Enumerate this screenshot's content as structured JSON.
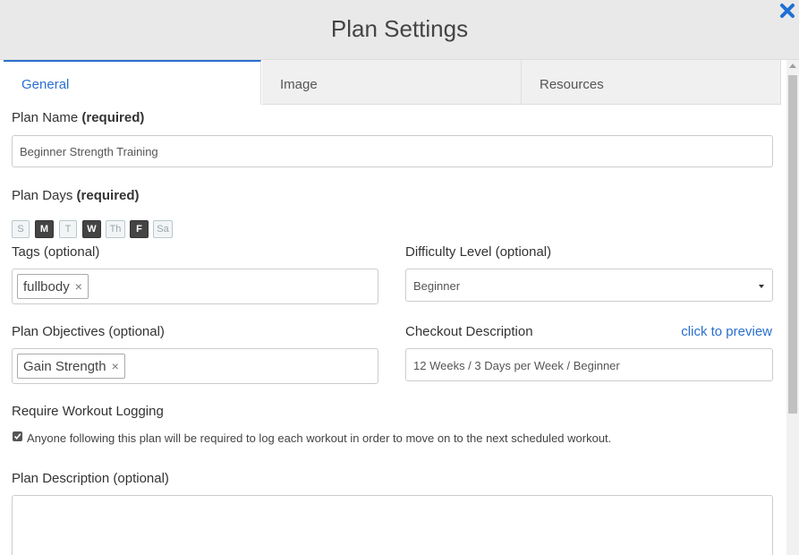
{
  "header": {
    "title": "Plan Settings"
  },
  "tabs": [
    {
      "label": "General",
      "active": true
    },
    {
      "label": "Image",
      "active": false
    },
    {
      "label": "Resources",
      "active": false
    }
  ],
  "plan_name": {
    "label": "Plan Name",
    "required": "(required)",
    "value": "Beginner Strength Training"
  },
  "plan_days": {
    "label": "Plan Days",
    "required": "(required)",
    "days": [
      {
        "label": "S",
        "selected": false
      },
      {
        "label": "M",
        "selected": true
      },
      {
        "label": "T",
        "selected": false
      },
      {
        "label": "W",
        "selected": true
      },
      {
        "label": "Th",
        "selected": false
      },
      {
        "label": "F",
        "selected": true
      },
      {
        "label": "Sa",
        "selected": false
      }
    ]
  },
  "tags": {
    "label": "Tags (optional)",
    "chips": [
      "fullbody"
    ]
  },
  "difficulty": {
    "label": "Difficulty Level (optional)",
    "value": "Beginner"
  },
  "objectives": {
    "label": "Plan Objectives (optional)",
    "chips": [
      "Gain Strength"
    ]
  },
  "checkout": {
    "label": "Checkout Description",
    "preview_link": "click to preview",
    "value": "12 Weeks / 3 Days per Week / Beginner"
  },
  "logging": {
    "label": "Require Workout Logging",
    "checked": true,
    "text": "Anyone following this plan will be required to log each workout in order to move on to the next scheduled workout."
  },
  "description": {
    "label": "Plan Description (optional)",
    "value": ""
  },
  "colors": {
    "accent": "#2a6fce",
    "close": "#1f6fd6",
    "day_selected": "#444444"
  },
  "chip_remove_glyph": "×"
}
